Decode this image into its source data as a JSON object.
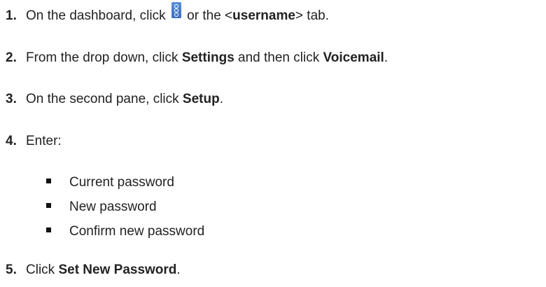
{
  "steps": [
    {
      "number": "1.",
      "t1": "On the dashboard, click ",
      "t2": " or the <",
      "b1": "username",
      "t3": "> tab.",
      "icon": "kebab-menu-icon"
    },
    {
      "number": "2.",
      "t1": "From the drop down, click ",
      "b1": "Settings",
      "t2": " and then click ",
      "b2": "Voicemail",
      "t3": "."
    },
    {
      "number": "3.",
      "t1": "On the second pane, click ",
      "b1": "Setup",
      "t2": "."
    },
    {
      "number": "4.",
      "t1": "Enter:"
    },
    {
      "number": "5.",
      "t1": "Click ",
      "b1": "Set New Password",
      "t2": "."
    }
  ],
  "sub_items": [
    "Current password",
    "New password",
    "Confirm new password"
  ],
  "colors": {
    "text": "#222222",
    "icon_blue": "#3c6fc0"
  }
}
